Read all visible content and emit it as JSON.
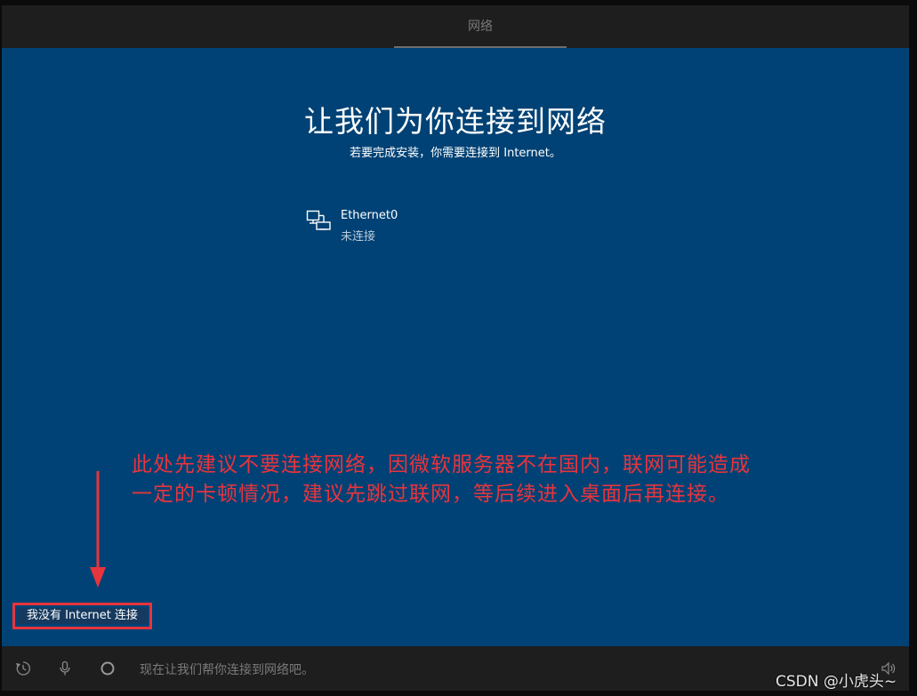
{
  "topbar": {
    "tab_label": "网络"
  },
  "main": {
    "title": "让我们为你连接到网络",
    "subtitle": "若要完成安装，你需要连接到 Internet。",
    "networks": [
      {
        "name": "Ethernet0",
        "status": "未连接",
        "icon": "ethernet-icon"
      }
    ]
  },
  "annotation": {
    "line1": "此处先建议不要连接网络，因微软服务器不在国内，联网可能造成",
    "line2": "一定的卡顿情况，建议先跳过联网，等后续进入桌面后再连接。",
    "color": "#e8343d"
  },
  "no_internet_button": {
    "label": "我没有 Internet 连接"
  },
  "bottombar": {
    "icons": [
      "accessibility-icon",
      "microphone-icon",
      "cortana-icon",
      "volume-icon"
    ],
    "cortana_text": "现在让我们帮你连接到网络吧。"
  },
  "watermark": {
    "text": "CSDN @小虎头~"
  },
  "colors": {
    "background": "#004275",
    "bar": "#1e1e1e",
    "accent_red": "#e8343d"
  }
}
